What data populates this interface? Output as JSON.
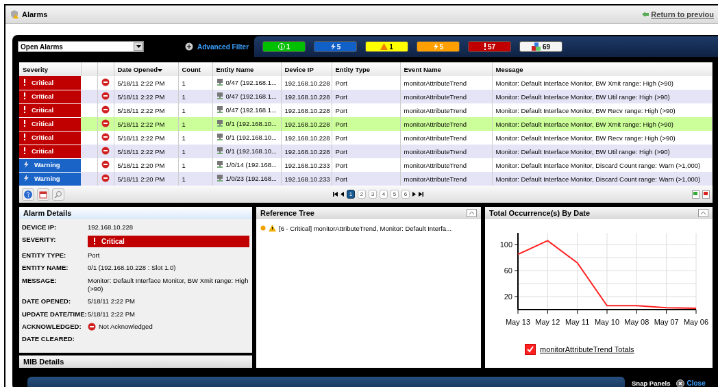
{
  "window": {
    "title": "Alarms",
    "return_link": "Return to previou"
  },
  "filter": {
    "view": "Open Alarms",
    "advanced_filter": "Advanced Filter"
  },
  "counters": [
    {
      "kind": "info",
      "count": "1",
      "color": "#00c000"
    },
    {
      "kind": "warning",
      "count": "5",
      "color": "#1060c8"
    },
    {
      "kind": "minor",
      "count": "1",
      "color": "#ffff00"
    },
    {
      "kind": "major",
      "count": "5",
      "color": "#ffa000"
    },
    {
      "kind": "critical",
      "count": "57",
      "color": "#c00000"
    },
    {
      "kind": "total",
      "count": "69",
      "color": "#f4f4f4"
    }
  ],
  "table": {
    "columns": [
      {
        "label": "Severity",
        "sorted": false
      },
      {
        "sorted": false
      },
      {
        "sorted": false
      },
      {
        "label": "Date Opened",
        "sorted": true
      },
      {
        "label": "Count",
        "sorted": false
      },
      {
        "label": "Entity Name",
        "sorted": false
      },
      {
        "label": "Device IP",
        "sorted": false
      },
      {
        "label": "Entity Type",
        "sorted": false
      },
      {
        "label": "Event Name",
        "sorted": false
      },
      {
        "label": "Message",
        "sorted": false
      }
    ],
    "rows": [
      {
        "severity": "Critical",
        "kind": "critical",
        "selected": false,
        "date": "5/18/11 2:22 PM",
        "count": "1",
        "entity": "0/47 (192.168.1...",
        "ip": "192.168.10.228",
        "type": "Port",
        "event": "monitorAttributeTrend",
        "message": "Monitor: Default Interface Monitor, BW Xmit range: High (>90)"
      },
      {
        "severity": "Critical",
        "kind": "critical",
        "selected": false,
        "date": "5/18/11 2:22 PM",
        "count": "1",
        "entity": "0/47 (192.168.1...",
        "ip": "192.168.10.228",
        "type": "Port",
        "event": "monitorAttributeTrend",
        "message": "Monitor: Default Interface Monitor, BW Util range: High (>90)"
      },
      {
        "severity": "Critical",
        "kind": "critical",
        "selected": false,
        "date": "5/18/11 2:22 PM",
        "count": "1",
        "entity": "0/47 (192.168.1...",
        "ip": "192.168.10.228",
        "type": "Port",
        "event": "monitorAttributeTrend",
        "message": "Monitor: Default Interface Monitor, BW Recv range: High (>90)"
      },
      {
        "severity": "Critical",
        "kind": "critical",
        "selected": true,
        "date": "5/18/11 2:22 PM",
        "count": "1",
        "entity": "0/1 (192.168.10...",
        "ip": "192.168.10.228",
        "type": "Port",
        "event": "monitorAttributeTrend",
        "message": "Monitor: Default Interface Monitor, BW Xmit range: High (>90)"
      },
      {
        "severity": "Critical",
        "kind": "critical",
        "selected": false,
        "date": "5/18/11 2:22 PM",
        "count": "1",
        "entity": "0/1 (192.168.10...",
        "ip": "192.168.10.228",
        "type": "Port",
        "event": "monitorAttributeTrend",
        "message": "Monitor: Default Interface Monitor, BW Recv range: High (>90)"
      },
      {
        "severity": "Critical",
        "kind": "critical",
        "selected": false,
        "date": "5/18/11 2:22 PM",
        "count": "1",
        "entity": "0/1 (192.168.10...",
        "ip": "192.168.10.228",
        "type": "Port",
        "event": "monitorAttributeTrend",
        "message": "Monitor: Default Interface Monitor, BW Util range: High (>90)"
      },
      {
        "severity": "Warning",
        "kind": "warning",
        "selected": false,
        "date": "5/18/11 2:20 PM",
        "count": "1",
        "entity": "1/0/14 (192.168...",
        "ip": "192.168.10.233",
        "type": "Port",
        "event": "monitorAttributeTrend",
        "message": "Monitor: Default Interface Monitor, Discard Count range: Warn (>1,000)"
      },
      {
        "severity": "Warning",
        "kind": "warning",
        "selected": false,
        "date": "5/18/11 2:20 PM",
        "count": "1",
        "entity": "1/0/23 (192.168...",
        "ip": "192.168.10.233",
        "type": "Port",
        "event": "monitorAttributeTrend",
        "message": "Monitor: Default Interface Monitor, Discard Count range: Warn (>1,000)"
      }
    ]
  },
  "pagination": [
    {
      "label": "1",
      "selected": true
    },
    {
      "label": "2",
      "selected": false
    },
    {
      "label": "3",
      "selected": false
    },
    {
      "label": "4",
      "selected": false
    },
    {
      "label": "5",
      "selected": false
    },
    {
      "label": "6",
      "selected": false
    }
  ],
  "alarm_details": {
    "title": "Alarm Details",
    "fields": [
      {
        "label": "DEVICE IP:",
        "kind": "text",
        "value": "192.168.10.228"
      },
      {
        "label": "SEVERITY:",
        "kind": "critical",
        "value": "Critical"
      },
      {
        "label": "ENTITY TYPE:",
        "kind": "text",
        "value": "Port"
      },
      {
        "label": "ENTITY NAME:",
        "kind": "text",
        "value": "0/1 (192.168.10.228 : Slot 1.0)"
      },
      {
        "label": "MESSAGE:",
        "kind": "text",
        "value": "Monitor: Default Interface Monitor, BW Xmit range: High (>90)"
      },
      {
        "label": "DATE OPENED:",
        "kind": "text",
        "value": "5/18/11 2:22 PM"
      },
      {
        "label": "UPDATE DATE/TIME:",
        "kind": "text",
        "value": "5/18/11 2:22 PM"
      },
      {
        "label": "ACKNOWLEDGED:",
        "kind": "ack",
        "value": "Not Acknowledged"
      },
      {
        "label": "DATE CLEARED:",
        "kind": "text"
      }
    ],
    "mib_title": "MIB Details"
  },
  "reference_tree": {
    "title": "Reference Tree",
    "items": [
      "[6 - Critical] monitorAttributeTrend, Monitor: Default Interfa..."
    ]
  },
  "occurrences": {
    "title": "Total Occurrence(s) By Date",
    "legend_checked": true,
    "chart_data": {
      "type": "line",
      "categories": [
        "May 13",
        "May 12",
        "May 11",
        "May 10",
        "May 08",
        "May 07",
        "May 06"
      ],
      "series": [
        {
          "name": "monitorAttributeTrend Totals",
          "color": "#ff2020",
          "values": [
            85,
            106,
            72,
            6,
            6,
            3,
            2
          ]
        }
      ],
      "ylim": [
        0,
        118
      ],
      "grid": true,
      "yticks": [
        20,
        60,
        100
      ]
    }
  },
  "footer": {
    "snap": "Snap Panels",
    "close": "Close"
  }
}
